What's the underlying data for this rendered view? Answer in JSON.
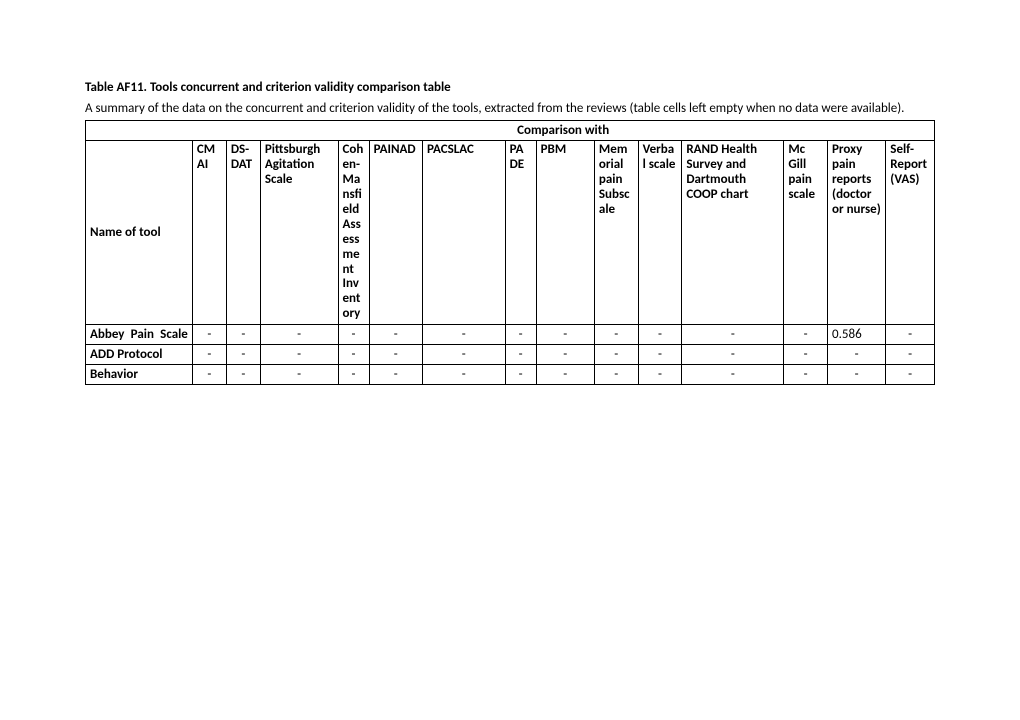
{
  "title": "Table AF11. Tools concurrent and criterion validity comparison table",
  "summary": "A summary of the data on the concurrent and criterion validity of the tools, extracted from the reviews (table cells left empty when no data were available).",
  "comparison_with": "Comparison with",
  "name_of_tool": "Name of tool",
  "columns": {
    "c1": "CMAI",
    "c2": "DS-DAT",
    "c3": "Pittsburgh Agitation Scale",
    "c4": "Cohen-Mansfield Assessment Inventory",
    "c5": "PAINAD",
    "c6": "PACSLAC",
    "c7": "PADE",
    "c8": "PBM",
    "c9": "Memorial pain Subscale",
    "c10": "Verbal scale",
    "c11": "RAND Health Survey and Dartmouth COOP chart",
    "c12": "Mc Gill pain scale",
    "c13": "Proxy pain reports (doctor or nurse)",
    "c14": "Self-Report (VAS)"
  },
  "rows": [
    {
      "label": "Abbey Pain Scale",
      "vals": [
        "-",
        "-",
        "-",
        "-",
        "-",
        "-",
        "-",
        "-",
        "-",
        "-",
        "-",
        "-",
        "0.586",
        "-"
      ]
    },
    {
      "label": "ADD Protocol",
      "vals": [
        "-",
        "-",
        "-",
        "-",
        "-",
        "-",
        "-",
        "-",
        "-",
        "-",
        "-",
        "-",
        "-",
        "-"
      ]
    },
    {
      "label": "Behavior",
      "vals": [
        "-",
        "-",
        "-",
        "-",
        "-",
        "-",
        "-",
        "-",
        "-",
        "-",
        "-",
        "-",
        "-",
        "-"
      ]
    }
  ]
}
